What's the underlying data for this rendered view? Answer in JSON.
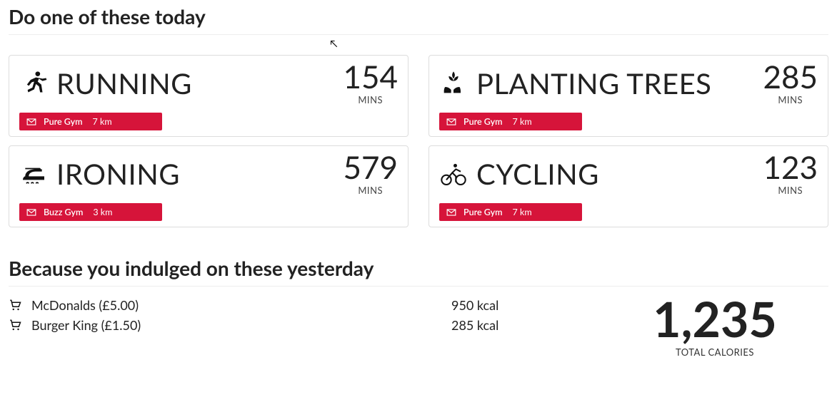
{
  "sections": {
    "today_title": "Do one of these today",
    "yesterday_title": "Because you indulged on these yesterday"
  },
  "mins_label": "MINS",
  "activities": [
    {
      "name": "RUNNING",
      "mins": "154",
      "gym": "Pure Gym",
      "dist": "7 km",
      "icon": "running"
    },
    {
      "name": "PLANTING TREES",
      "mins": "285",
      "gym": "Pure Gym",
      "dist": "7 km",
      "icon": "planting"
    },
    {
      "name": "IRONING",
      "mins": "579",
      "gym": "Buzz Gym",
      "dist": "3 km",
      "icon": "ironing"
    },
    {
      "name": "CYCLING",
      "mins": "123",
      "gym": "Pure Gym",
      "dist": "7 km",
      "icon": "cycling"
    }
  ],
  "foods": [
    {
      "name": "McDonalds (£5.00)",
      "kcal": "950 kcal"
    },
    {
      "name": "Burger King (£1.50)",
      "kcal": "285 kcal"
    }
  ],
  "totals": {
    "value": "1,235",
    "label": "TOTAL CALORIES"
  }
}
